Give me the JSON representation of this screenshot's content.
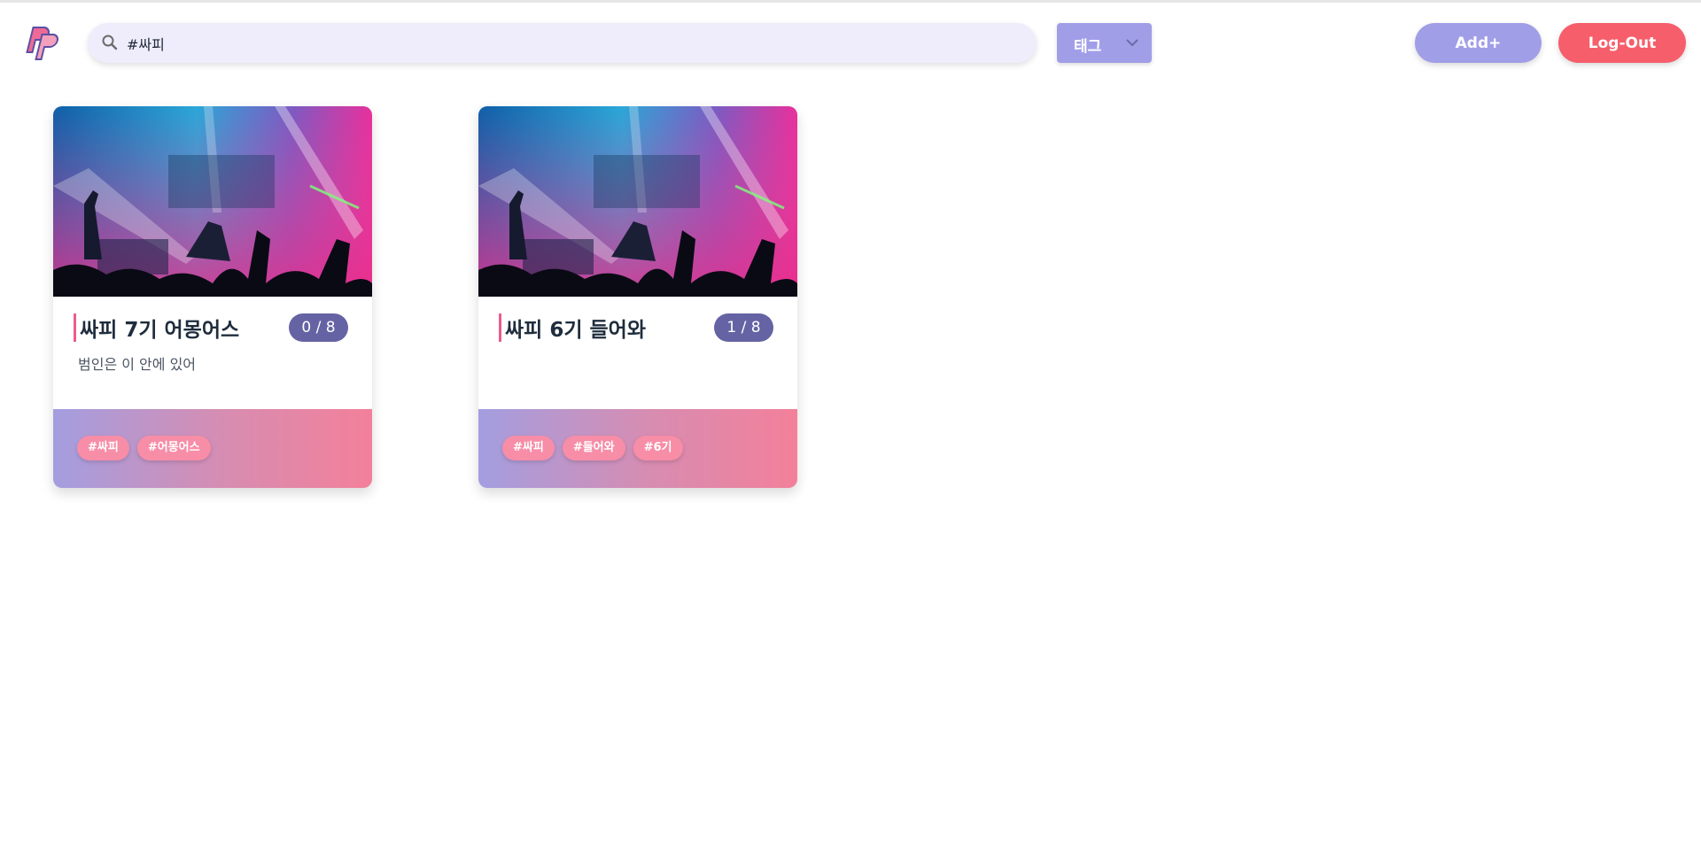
{
  "header": {
    "logo_text": "PP",
    "search": {
      "value": "#싸피",
      "placeholder": ""
    },
    "tag_select": {
      "label": "태그"
    },
    "add_label": "Add+",
    "logout_label": "Log-Out"
  },
  "colors": {
    "accent": "#a19ee8",
    "danger": "#f65e6b",
    "badge": "#6563a3",
    "tag": "#f78da7"
  },
  "rooms": [
    {
      "title": "싸피 7기 어몽어스",
      "players": "0 / 8",
      "description": "범인은 이 안에 있어",
      "tags": [
        "#싸피",
        "#어몽어스"
      ]
    },
    {
      "title": "싸피 6기 들어와",
      "players": "1 / 8",
      "description": "",
      "tags": [
        "#싸피",
        "#들어와",
        "#6기"
      ]
    }
  ]
}
